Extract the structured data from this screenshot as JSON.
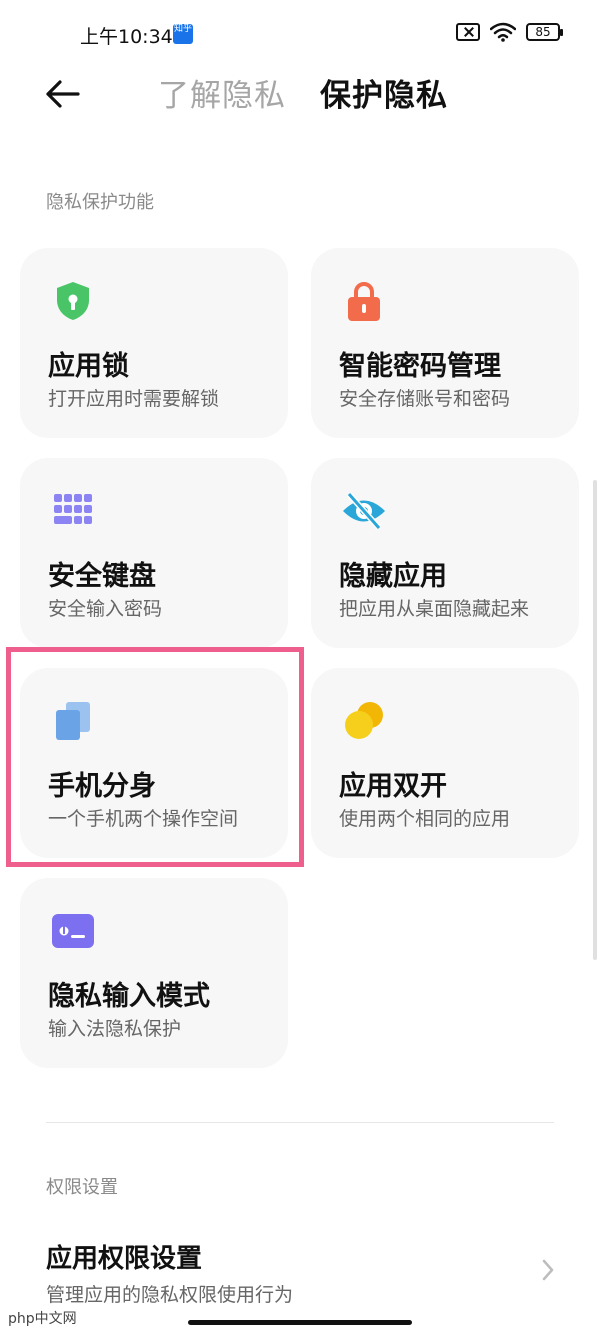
{
  "status_bar": {
    "time": "上午10:34",
    "badge": "知乎",
    "battery": "85"
  },
  "header": {
    "tabs": [
      {
        "label": "了解隐私"
      },
      {
        "label": "保护隐私"
      }
    ]
  },
  "sections": {
    "privacy_protection": "隐私保护功能",
    "permissions": "权限设置"
  },
  "cards": [
    {
      "title": "应用锁",
      "subtitle": "打开应用时需要解锁",
      "icon": "shield-icon",
      "color": "#49c568"
    },
    {
      "title": "智能密码管理",
      "subtitle": "安全存储账号和密码",
      "icon": "lock-icon",
      "color": "#f26b4a"
    },
    {
      "title": "安全键盘",
      "subtitle": "安全输入密码",
      "icon": "keyboard-icon",
      "color": "#8c84f2"
    },
    {
      "title": "隐藏应用",
      "subtitle": "把应用从桌面隐藏起来",
      "icon": "eye-off-icon",
      "color": "#2aa7d8"
    },
    {
      "title": "手机分身",
      "subtitle": "一个手机两个操作空间",
      "icon": "second-space-icon",
      "color": "#6aa3e6"
    },
    {
      "title": "应用双开",
      "subtitle": "使用两个相同的应用",
      "icon": "dual-app-icon",
      "color": "#f6cf1c"
    },
    {
      "title": "隐私输入模式",
      "subtitle": "输入法隐私保护",
      "icon": "terminal-icon",
      "color": "#7c6ff0"
    }
  ],
  "permission_row": {
    "title": "应用权限设置",
    "subtitle": "管理应用的隐私权限使用行为"
  },
  "watermark": "php中文网"
}
